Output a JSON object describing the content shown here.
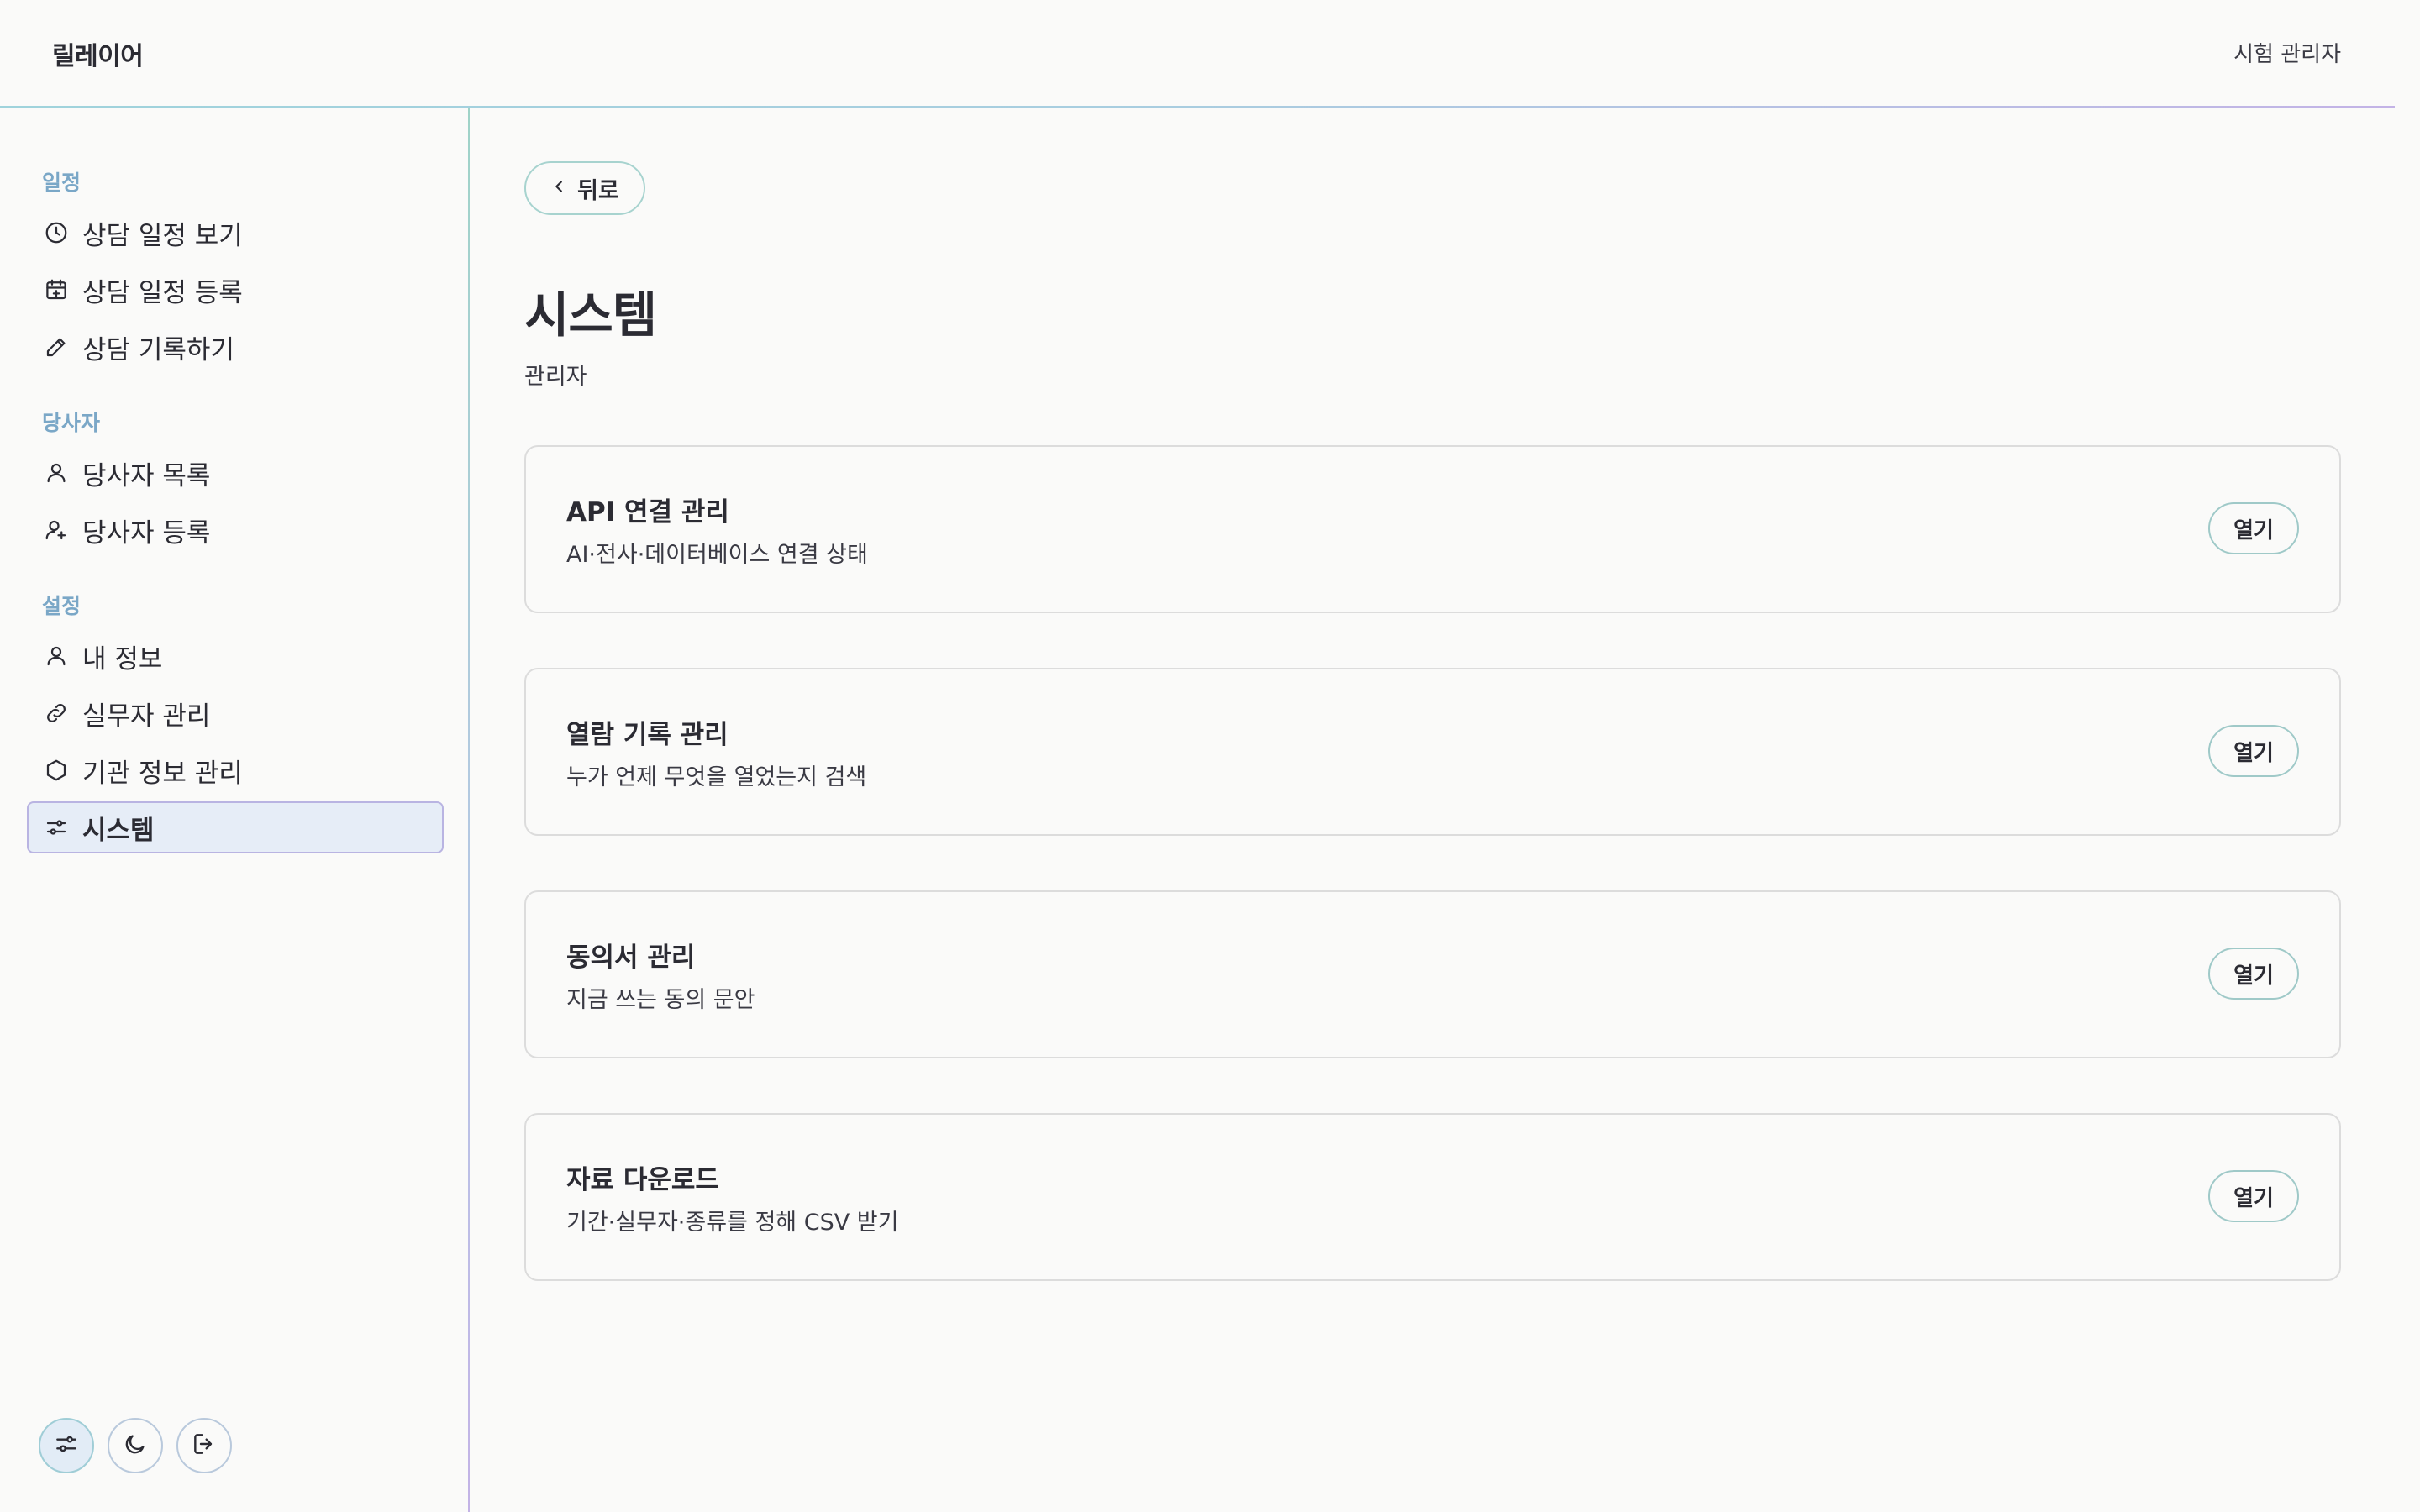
{
  "app": {
    "brand": "릴레이어",
    "user": "시험 관리자"
  },
  "sidebar": {
    "sections": [
      {
        "label": "일정",
        "items": [
          {
            "label": "상담 일정 보기",
            "icon": "clock-icon"
          },
          {
            "label": "상담 일정 등록",
            "icon": "calendar-plus-icon"
          },
          {
            "label": "상담 기록하기",
            "icon": "pencil-icon"
          }
        ]
      },
      {
        "label": "당사자",
        "items": [
          {
            "label": "당사자 목록",
            "icon": "user-icon"
          },
          {
            "label": "당사자 등록",
            "icon": "user-plus-icon"
          }
        ]
      },
      {
        "label": "설정",
        "items": [
          {
            "label": "내 정보",
            "icon": "user-icon"
          },
          {
            "label": "실무자 관리",
            "icon": "link-icon"
          },
          {
            "label": "기관 정보 관리",
            "icon": "hexagon-icon"
          },
          {
            "label": "시스템",
            "icon": "sliders-icon",
            "active": true
          }
        ]
      }
    ],
    "bottom": [
      {
        "icon": "sliders-icon",
        "active": true
      },
      {
        "icon": "moon-icon"
      },
      {
        "icon": "logout-icon"
      }
    ]
  },
  "main": {
    "back_label": "뒤로",
    "title": "시스템",
    "subtitle": "관리자",
    "cards": [
      {
        "title": "API 연결 관리",
        "desc": "AI·전사·데이터베이스 연결 상태",
        "button": "열기"
      },
      {
        "title": "열람 기록 관리",
        "desc": "누가 언제 무엇을 열었는지 검색",
        "button": "열기"
      },
      {
        "title": "동의서 관리",
        "desc": "지금 쓰는 동의 문안",
        "button": "열기"
      },
      {
        "title": "자료 다운로드",
        "desc": "기간·실무자·종류를 정해 CSV 받기",
        "button": "열기"
      }
    ]
  }
}
